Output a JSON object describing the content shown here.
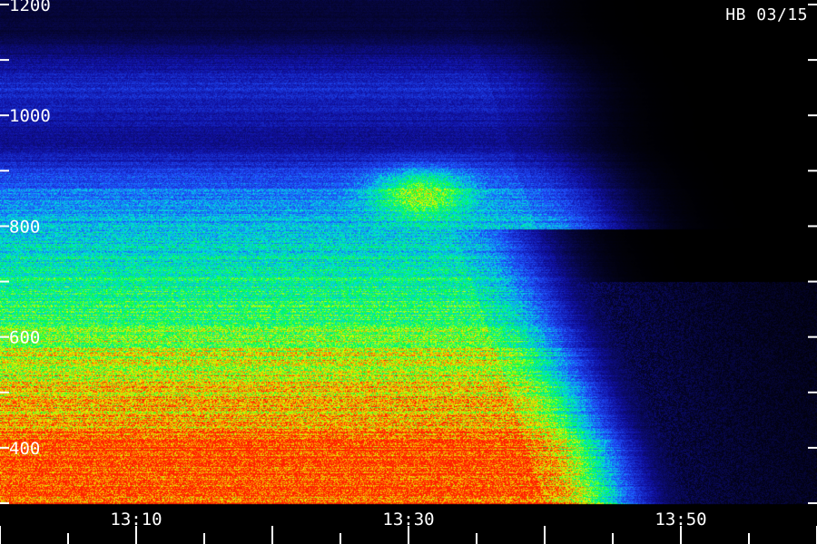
{
  "station_label": "HB 03/15",
  "chart_data": {
    "type": "heatmap",
    "title": "",
    "xlabel": "",
    "ylabel": "",
    "x_ticks": [
      "13:10",
      "13:30",
      "13:50"
    ],
    "y_ticks": [
      400,
      600,
      800,
      1000,
      1200
    ],
    "x_range_minutes": [
      "13:00",
      "13:59"
    ],
    "ylim": [
      300,
      1200
    ],
    "colormap": [
      "#000000",
      "#1010a0",
      "#2050ff",
      "#00e0e0",
      "#00ff40",
      "#e0ff00",
      "#ffa000",
      "#ff2000"
    ],
    "intensity_profile": {
      "description_units": "frequency vs relative intensity (0-1) before onset",
      "bands": [
        {
          "freq": 400,
          "intensity": 1.0
        },
        {
          "freq": 450,
          "intensity": 0.85
        },
        {
          "freq": 550,
          "intensity": 0.75
        },
        {
          "freq": 650,
          "intensity": 0.55
        },
        {
          "freq": 750,
          "intensity": 0.45
        },
        {
          "freq": 850,
          "intensity": 0.35
        },
        {
          "freq": 950,
          "intensity": 0.12
        },
        {
          "freq": 1050,
          "intensity": 0.2
        },
        {
          "freq": 1150,
          "intensity": 0.05
        }
      ],
      "fade_start_time": "13:28",
      "fade_end_time": "13:48"
    }
  }
}
